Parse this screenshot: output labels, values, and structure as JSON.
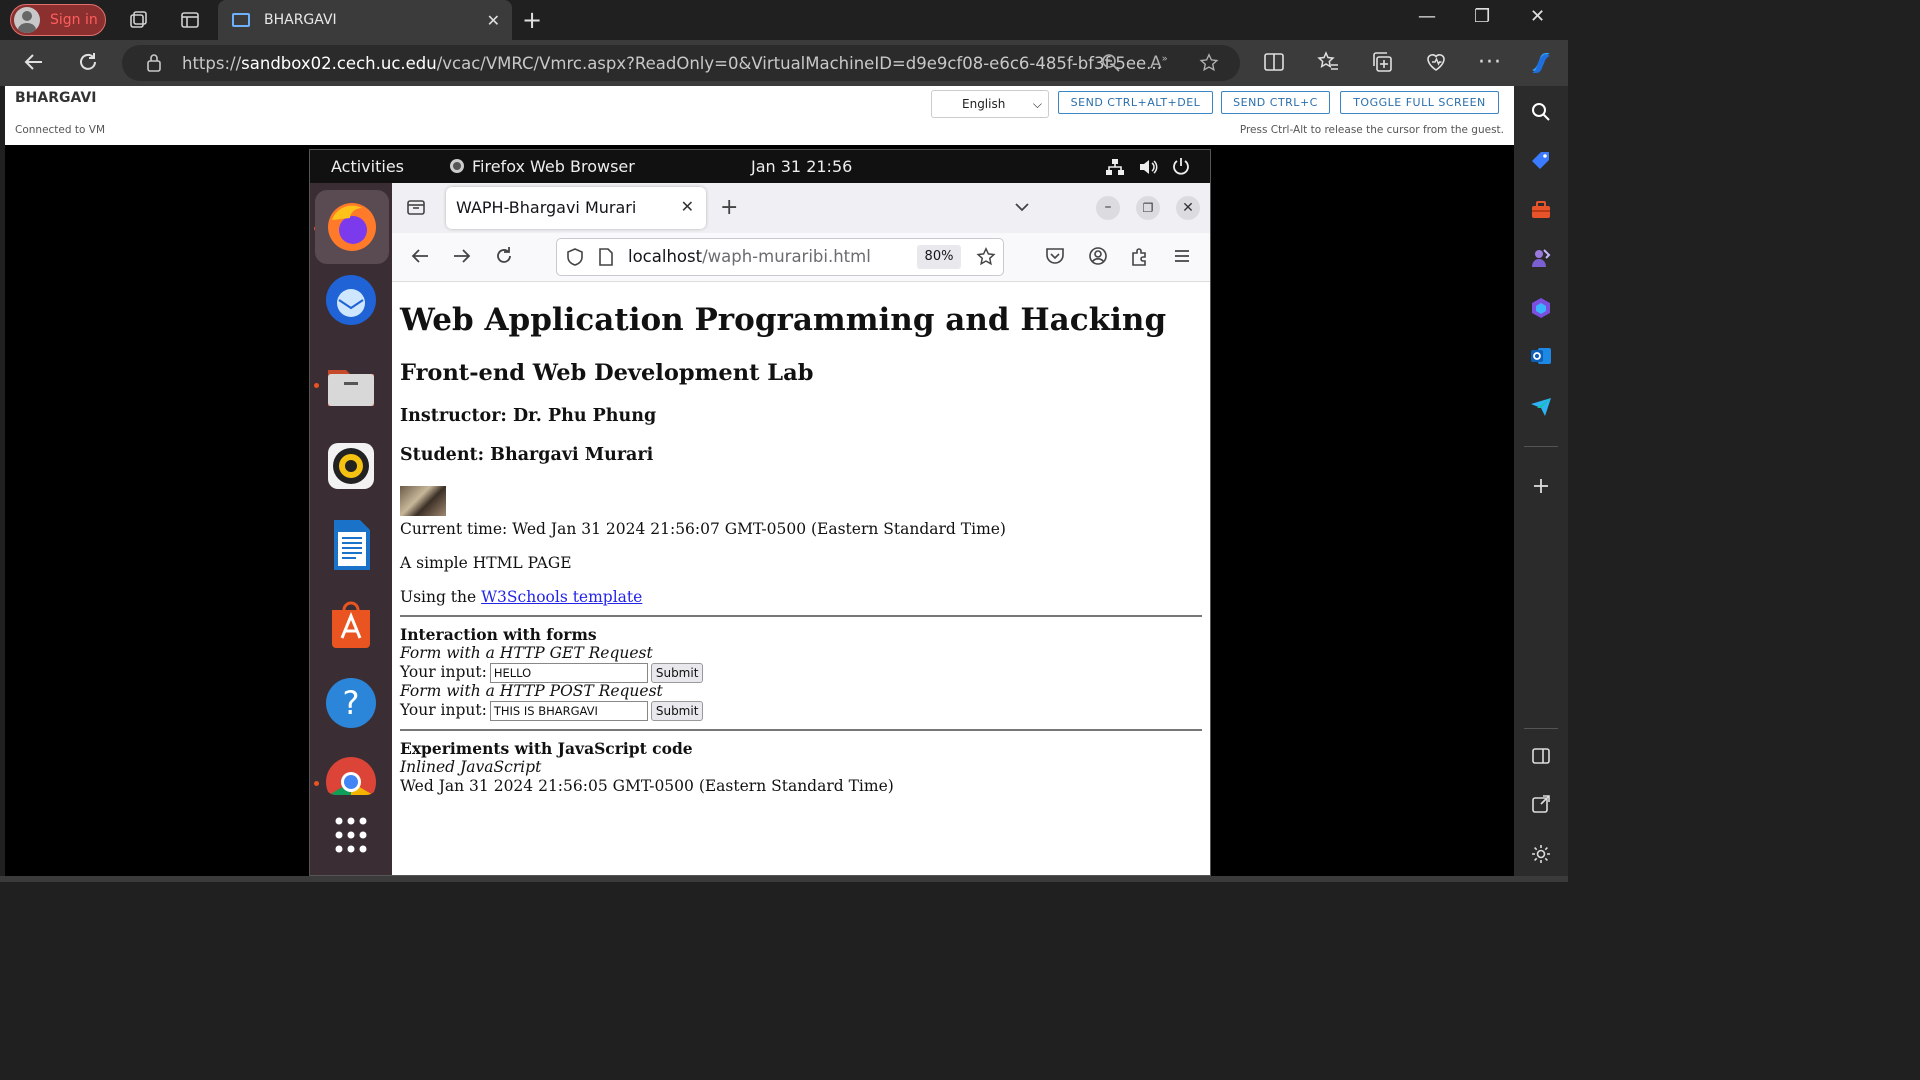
{
  "browser": {
    "signin_label": "Sign in",
    "tab_title": "BHARGAVI",
    "url_prefix": "https://",
    "url_host": "sandbox02.cech.uc.edu",
    "url_path": "/vcac/VMRC/Vmrc.aspx?ReadOnly=0&VirtualMachineID=d9e9cf08-e6c6-485f-bf3f-5ee..."
  },
  "vmrc": {
    "title": "BHARGAVI",
    "status": "Connected to VM",
    "language": "English",
    "buttons": [
      "SEND CTRL+ALT+DEL",
      "SEND CTRL+C",
      "TOGGLE FULL SCREEN"
    ],
    "hint": "Press Ctrl-Alt to release the cursor from the guest."
  },
  "guest": {
    "activities": "Activities",
    "app_name": "Firefox Web Browser",
    "clock": "Jan 31  21:56"
  },
  "firefox": {
    "tab_title": "WAPH-Bhargavi Murari",
    "url_host": "localhost",
    "url_path": "/waph-muraribi.html",
    "zoom": "80%"
  },
  "page": {
    "h1": "Web Application Programming and Hacking",
    "h2": "Front-end Web Development Lab",
    "instructor": "Instructor: Dr. Phu Phung",
    "student": "Student: Bhargavi Murari",
    "current_time": "Current time: Wed Jan 31 2024 21:56:07 GMT-0500 (Eastern Standard Time)",
    "simple": "A simple HTML PAGE",
    "using_prefix": "Using the ",
    "using_link": "W3Schools template",
    "forms_heading": "Interaction with forms",
    "get_label": "Form with a HTTP GET Request",
    "input_label": "Your input:",
    "get_value": "HELLO",
    "post_label": "Form with a HTTP POST Request",
    "post_value": "THIS IS BHARGAVI",
    "submit_label": "Submit",
    "js_heading": "Experiments with JavaScript code",
    "js_sub": "Inlined JavaScript",
    "js_output": "Wed Jan 31 2024 21:56:05 GMT-0500 (Eastern Standard Time)"
  },
  "colors": {
    "edge_dark": "#202020",
    "vmrc_accent": "#3b86c4",
    "ubuntu_orange": "#e95420",
    "link": "#2424e6"
  }
}
